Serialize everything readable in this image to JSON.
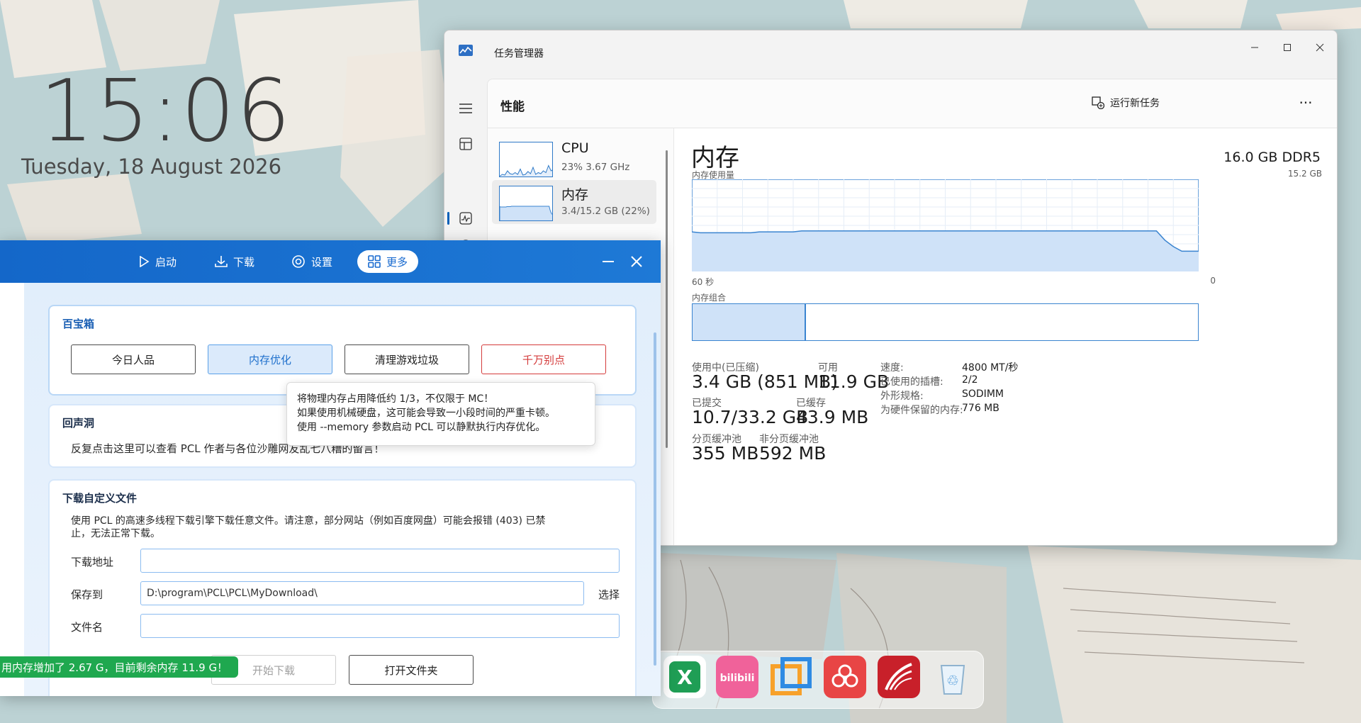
{
  "desktop": {
    "clock_time": "15:06",
    "clock_date": "Tuesday, 18 August 2026"
  },
  "dock": {
    "icons": [
      {
        "name": "excel-icon",
        "glyph": "X",
        "color": "#1f9e55"
      },
      {
        "name": "bilibili-icon",
        "glyph": "bilibili",
        "color": "#f0629a"
      },
      {
        "name": "window-app-icon",
        "glyph": "",
        "color": "#2f8be3"
      },
      {
        "name": "flower-app-icon",
        "glyph": "",
        "color": "#e84545"
      },
      {
        "name": "study-app-icon",
        "glyph": "",
        "color": "#c8202a"
      },
      {
        "name": "recycle-bin-icon",
        "glyph": "♲",
        "color": "#4a9ad8"
      }
    ]
  },
  "taskmgr": {
    "title": "任务管理器",
    "section_title": "性能",
    "run_new_task": "运行新任务",
    "more": "···",
    "perf_items": [
      {
        "name": "CPU",
        "sub": "23%  3.67 GHz"
      },
      {
        "name": "内存",
        "sub": "3.4/15.2 GB (22%)"
      }
    ],
    "memory": {
      "title": "内存",
      "spec": "16.0 GB DDR5",
      "usage_label": "内存使用量",
      "usage_max": "15.2 GB",
      "time_left": "60 秒",
      "time_right": "0",
      "composition_label": "内存组合",
      "composition_used_fraction": 0.225,
      "stats": {
        "in_use_label": "使用中(已压缩)",
        "in_use_value": "3.4 GB (851 MB)",
        "available_label": "可用",
        "available_value": "11.9 GB",
        "committed_label": "已提交",
        "committed_value": "10.7/33.2 GB",
        "cached_label": "已缓存",
        "cached_value": "43.9 MB",
        "paged_label": "分页缓冲池",
        "paged_value": "355 MB",
        "nonpaged_label": "非分页缓冲池",
        "nonpaged_value": "592 MB"
      },
      "specs": [
        {
          "label": "速度:",
          "value": "4800 MT/秒"
        },
        {
          "label": "已使用的插槽:",
          "value": "2/2"
        },
        {
          "label": "外形规格:",
          "value": "SODIMM"
        },
        {
          "label": "为硬件保留的内存:",
          "value": "776 MB"
        }
      ],
      "usage_history_fraction": [
        0.43,
        0.42,
        0.42,
        0.42,
        0.42,
        0.42,
        0.42,
        0.42,
        0.43,
        0.43,
        0.43,
        0.43,
        0.43,
        0.44,
        0.44,
        0.44,
        0.44,
        0.44,
        0.44,
        0.44,
        0.44,
        0.44,
        0.44,
        0.44,
        0.44,
        0.44,
        0.44,
        0.44,
        0.44,
        0.44,
        0.44,
        0.44,
        0.44,
        0.44,
        0.44,
        0.44,
        0.44,
        0.44,
        0.44,
        0.44,
        0.44,
        0.44,
        0.44,
        0.44,
        0.44,
        0.44,
        0.44,
        0.44,
        0.44,
        0.44,
        0.44,
        0.44,
        0.44,
        0.44,
        0.44,
        0.44,
        0.34,
        0.27,
        0.22,
        0.22,
        0.22
      ]
    },
    "cpu_history_fraction": [
      0.05,
      0.1,
      0.08,
      0.2,
      0.12,
      0.1,
      0.15,
      0.1,
      0.25,
      0.08,
      0.1,
      0.18,
      0.12,
      0.3,
      0.1,
      0.15,
      0.12,
      0.2,
      0.15,
      0.35,
      0.2,
      0.25
    ]
  },
  "pcl": {
    "nav": [
      {
        "label": "启动",
        "icon": "play-icon"
      },
      {
        "label": "下载",
        "icon": "download-icon"
      },
      {
        "label": "设置",
        "icon": "settings-icon"
      },
      {
        "label": "更多",
        "icon": "grid-icon"
      }
    ],
    "toolbox": {
      "title": "百宝箱",
      "buttons": [
        "今日人品",
        "内存优化",
        "清理游戏垃圾",
        "千万别点"
      ]
    },
    "tooltip": [
      "将物理内存占用降低约 1/3，不仅限于 MC！",
      "如果使用机械硬盘，这可能会导致一小段时间的严重卡顿。",
      "使用 --memory 参数启动 PCL 可以静默执行内存优化。"
    ],
    "echo": {
      "title": "回声洞",
      "text": "反复点击这里可以查看 PCL 作者与各位沙雕网友乱七八糟的留言！"
    },
    "download": {
      "title": "下载自定义文件",
      "desc_line1": "使用 PCL 的高速多线程下载引擎下载任意文件。请注意，部分网站（例如百度网盘）可能会报错 (403) 已禁",
      "desc_line2": "止，无法正常下载。",
      "url_label": "下载地址",
      "url_value": "",
      "save_label": "保存到",
      "save_value": "D:\\program\\PCL\\PCL\\MyDownload\\",
      "choose_label": "选择",
      "filename_label": "文件名",
      "filename_value": "",
      "start_button": "开始下载",
      "open_folder_button": "打开文件夹"
    },
    "toast": "用内存增加了 2.67 G，目前剩余内存 11.9 G！"
  }
}
